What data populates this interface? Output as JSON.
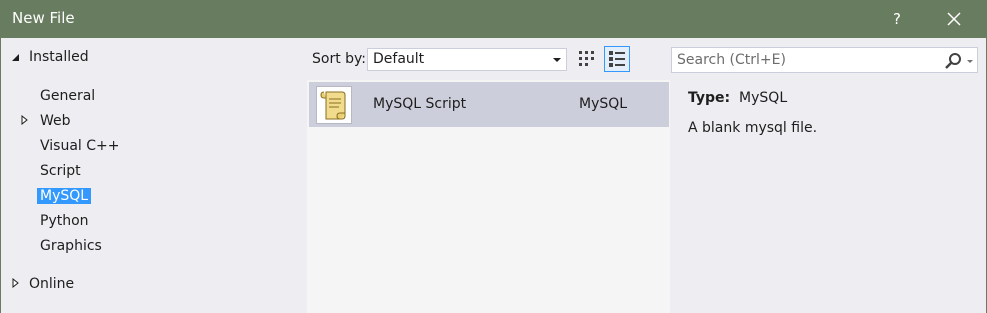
{
  "window": {
    "title": "New File",
    "help_label": "?",
    "close_icon": "close-icon"
  },
  "tree": {
    "installed_label": "Installed",
    "items": [
      {
        "label": "General",
        "expandable": false,
        "selected": false
      },
      {
        "label": "Web",
        "expandable": true,
        "selected": false
      },
      {
        "label": "Visual C++",
        "expandable": false,
        "selected": false
      },
      {
        "label": "Script",
        "expandable": false,
        "selected": false
      },
      {
        "label": "MySQL",
        "expandable": false,
        "selected": true
      },
      {
        "label": "Python",
        "expandable": false,
        "selected": false
      },
      {
        "label": "Graphics",
        "expandable": false,
        "selected": false
      }
    ],
    "online_label": "Online"
  },
  "toolbar": {
    "sort_label": "Sort by:",
    "sort_value": "Default",
    "view_small_icons": "small-icons-view-icon",
    "view_list": "list-view-icon",
    "active_view": "list"
  },
  "search": {
    "placeholder": "Search (Ctrl+E)",
    "icon": "search-icon"
  },
  "templates": [
    {
      "name": "MySQL Script",
      "language": "MySQL",
      "icon": "script-file-icon",
      "selected": true
    }
  ],
  "details": {
    "type_label": "Type:",
    "type_value": "MySQL",
    "description": "A blank mysql file."
  },
  "colors": {
    "titlebar": "#687c5f",
    "selection": "#3399ff",
    "row_selected": "#cccedb"
  }
}
